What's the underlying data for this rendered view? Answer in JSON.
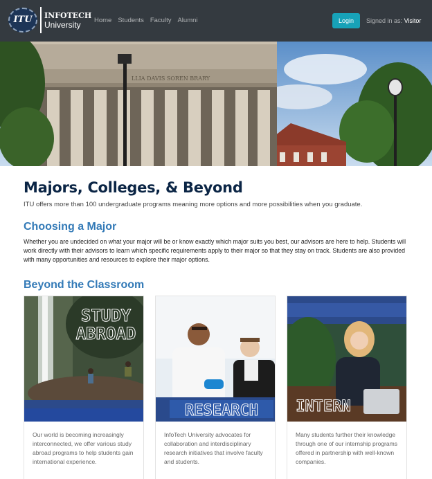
{
  "brand": {
    "seal_text": "ITU",
    "name_top": "INFOTECH",
    "name_bottom": "University"
  },
  "nav": {
    "links": [
      "Home",
      "Students",
      "Faculty",
      "Alumni"
    ],
    "login_label": "Login",
    "signed_in_prefix": "Signed in as:",
    "signed_in_user": "Visitor"
  },
  "hero": {
    "building_inscription": "LLIA  DAVIS  SOREN  BRARY"
  },
  "main": {
    "title": "Majors, Colleges, & Beyond",
    "subtitle": "ITU offers more than 100 undergraduate programs meaning more options and more possibilities when you graduate.",
    "choosing": {
      "heading": "Choosing a Major",
      "paragraph": "Whether you are undecided on what your major will be or know exactly which major suits you best, our advisors are here to help. Students will work directly with their advisors to learn which specific requirements apply to their major so that they stay on track. Students are also provided with many opportunities and resources to explore their major options."
    },
    "beyond": {
      "heading": "Beyond the Classroom",
      "cards": [
        {
          "image_word_1": "STUDY",
          "image_word_2": "ABROAD",
          "text": "Our world is becoming increasingly interconnected, we offer various study abroad programs to help students gain international experience."
        },
        {
          "image_word_1": "RESEARCH",
          "text": "InfoTech University advocates for collaboration and interdisciplinary research initiatives that involve faculty and students."
        },
        {
          "image_word_1": "INTERN",
          "text": "Many students further their knowledge through one of our internship programs offered in partnership with well-known companies."
        }
      ]
    }
  },
  "colors": {
    "navbar_bg": "#343a40",
    "login_bg": "#17a2b8",
    "title": "#0b2545",
    "heading_blue": "#337ab7"
  },
  "icons": [
    "university-seal-icon"
  ]
}
